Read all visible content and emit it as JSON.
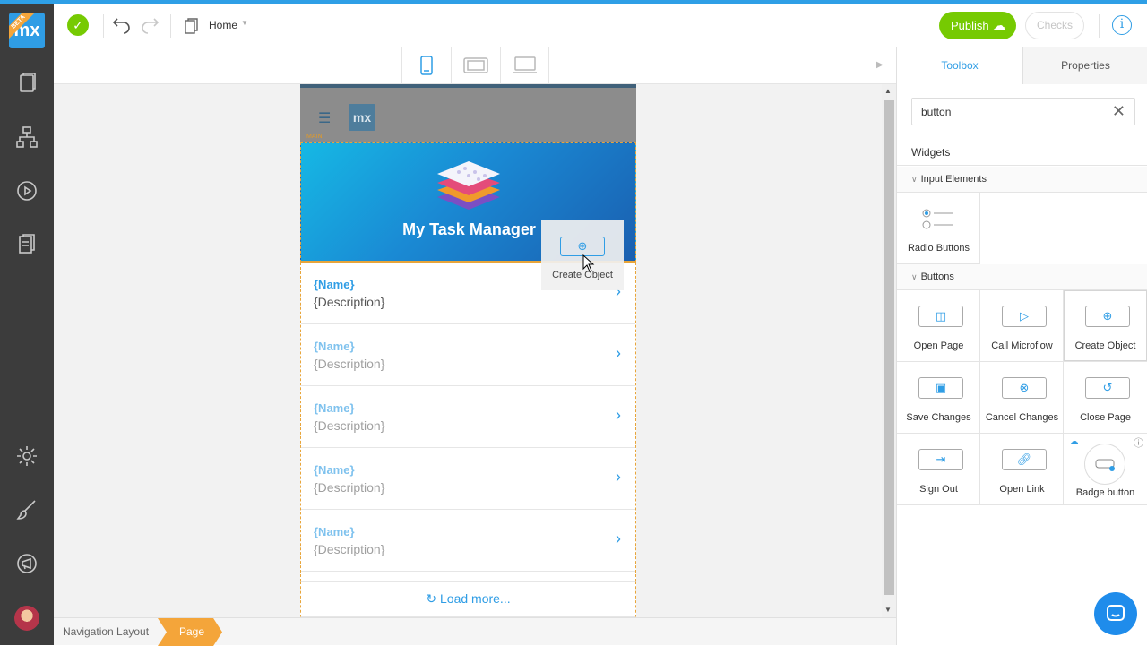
{
  "sidebar": {
    "logo_text": "mx",
    "beta_label": "BETA",
    "icons": [
      "pages-icon",
      "domain-model-icon",
      "run-icon",
      "documents-icon",
      "settings-icon",
      "theme-brush-icon",
      "feedback-icon"
    ]
  },
  "toolbar": {
    "page_name": "Home",
    "publish_label": "Publish",
    "checks_label": "Checks"
  },
  "canvas": {
    "nav_tag": "MAIN",
    "app_title": "My Task Manager",
    "rows": [
      {
        "name": "{Name}",
        "description": "{Description}"
      },
      {
        "name": "{Name}",
        "description": "{Description}"
      },
      {
        "name": "{Name}",
        "description": "{Description}"
      },
      {
        "name": "{Name}",
        "description": "{Description}"
      },
      {
        "name": "{Name}",
        "description": "{Description}"
      }
    ],
    "load_more": "Load more...",
    "drag_label": "Create Object"
  },
  "breadcrumb": {
    "layout": "Navigation Layout",
    "page": "Page"
  },
  "panel": {
    "tab_toolbox": "Toolbox",
    "tab_properties": "Properties",
    "search_value": "button",
    "widgets_heading": "Widgets",
    "input_elements_heading": "Input Elements",
    "buttons_heading": "Buttons",
    "input_elements": [
      "Radio Buttons"
    ],
    "buttons": [
      "Open Page",
      "Call Microflow",
      "Create Object",
      "Save Changes",
      "Cancel Changes",
      "Close Page",
      "Sign Out",
      "Open Link",
      "Badge button"
    ]
  },
  "colors": {
    "accent": "#2f9de5",
    "success": "#76ca02",
    "orange": "#f4a53a",
    "sidebar": "#3c3c3c"
  }
}
